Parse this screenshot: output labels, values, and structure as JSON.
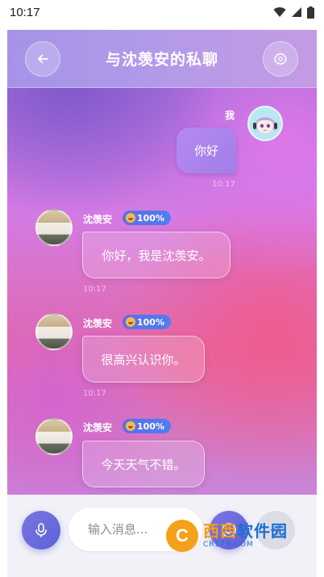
{
  "status_bar": {
    "time": "10:17"
  },
  "header": {
    "title": "与沈羡安的私聊"
  },
  "messages": [
    {
      "sender": "我",
      "text": "你好",
      "time": "10:17"
    },
    {
      "sender": "沈羡安",
      "badge": "100%",
      "text": "你好，我是沈羡安。",
      "time": "10:17"
    },
    {
      "sender": "沈羡安",
      "badge": "100%",
      "text": "很高兴认识你。",
      "time": "10:17"
    },
    {
      "sender": "沈羡安",
      "badge": "100%",
      "text": "今天天气不错。"
    }
  ],
  "input": {
    "placeholder": "输入消息..."
  },
  "watermark": {
    "brand_a": "西西",
    "brand_b": "软件园",
    "url": "CR173.COM"
  },
  "icons": {
    "back": "arrow-left-icon",
    "settings": "gear-icon",
    "mic": "microphone-icon",
    "emoji": "smile-icon",
    "send": "send-icon"
  },
  "colors": {
    "accent": "#6a6be0",
    "header": "#b39ae9",
    "badge": "#5270eb"
  }
}
